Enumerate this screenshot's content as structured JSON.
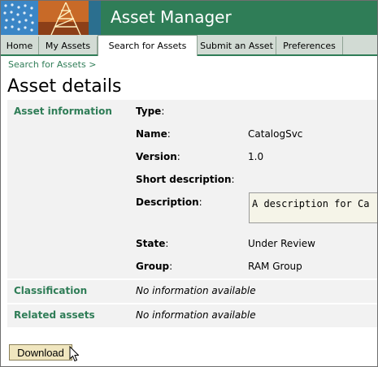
{
  "app": {
    "title": "Asset Manager"
  },
  "tabs": [
    {
      "label": "Home",
      "active": false
    },
    {
      "label": "My Assets",
      "active": false
    },
    {
      "label": "Search for Assets",
      "active": true
    },
    {
      "label": "Submit an Asset",
      "active": false
    },
    {
      "label": "Preferences",
      "active": false
    }
  ],
  "breadcrumb": "Search for Assets >",
  "page_title": "Asset details",
  "asset_info": {
    "section_label": "Asset information",
    "fields": [
      {
        "label": "Type",
        "value": ""
      },
      {
        "label": "Name",
        "value": "CatalogSvc"
      },
      {
        "label": "Version",
        "value": "1.0"
      },
      {
        "label": "Short description",
        "value": ""
      },
      {
        "label": "Description",
        "value": "A description for Ca"
      },
      {
        "label": "State",
        "value": "Under Review"
      },
      {
        "label": "Group",
        "value": "RAM Group"
      }
    ]
  },
  "classification": {
    "label": "Classification",
    "value": "No information available"
  },
  "related_assets": {
    "label": "Related assets",
    "value": "No information available"
  },
  "download_button": {
    "label": "Download"
  },
  "colors": {
    "banner": "#2f7d57",
    "accent_text": "#2f7d57",
    "tabbar": "#d2dbd4",
    "panel": "#f2f2f2",
    "button": "#f0e6bf"
  },
  "icons": {
    "logo": "globe-tower-logo",
    "cursor": "mouse-pointer-icon"
  }
}
